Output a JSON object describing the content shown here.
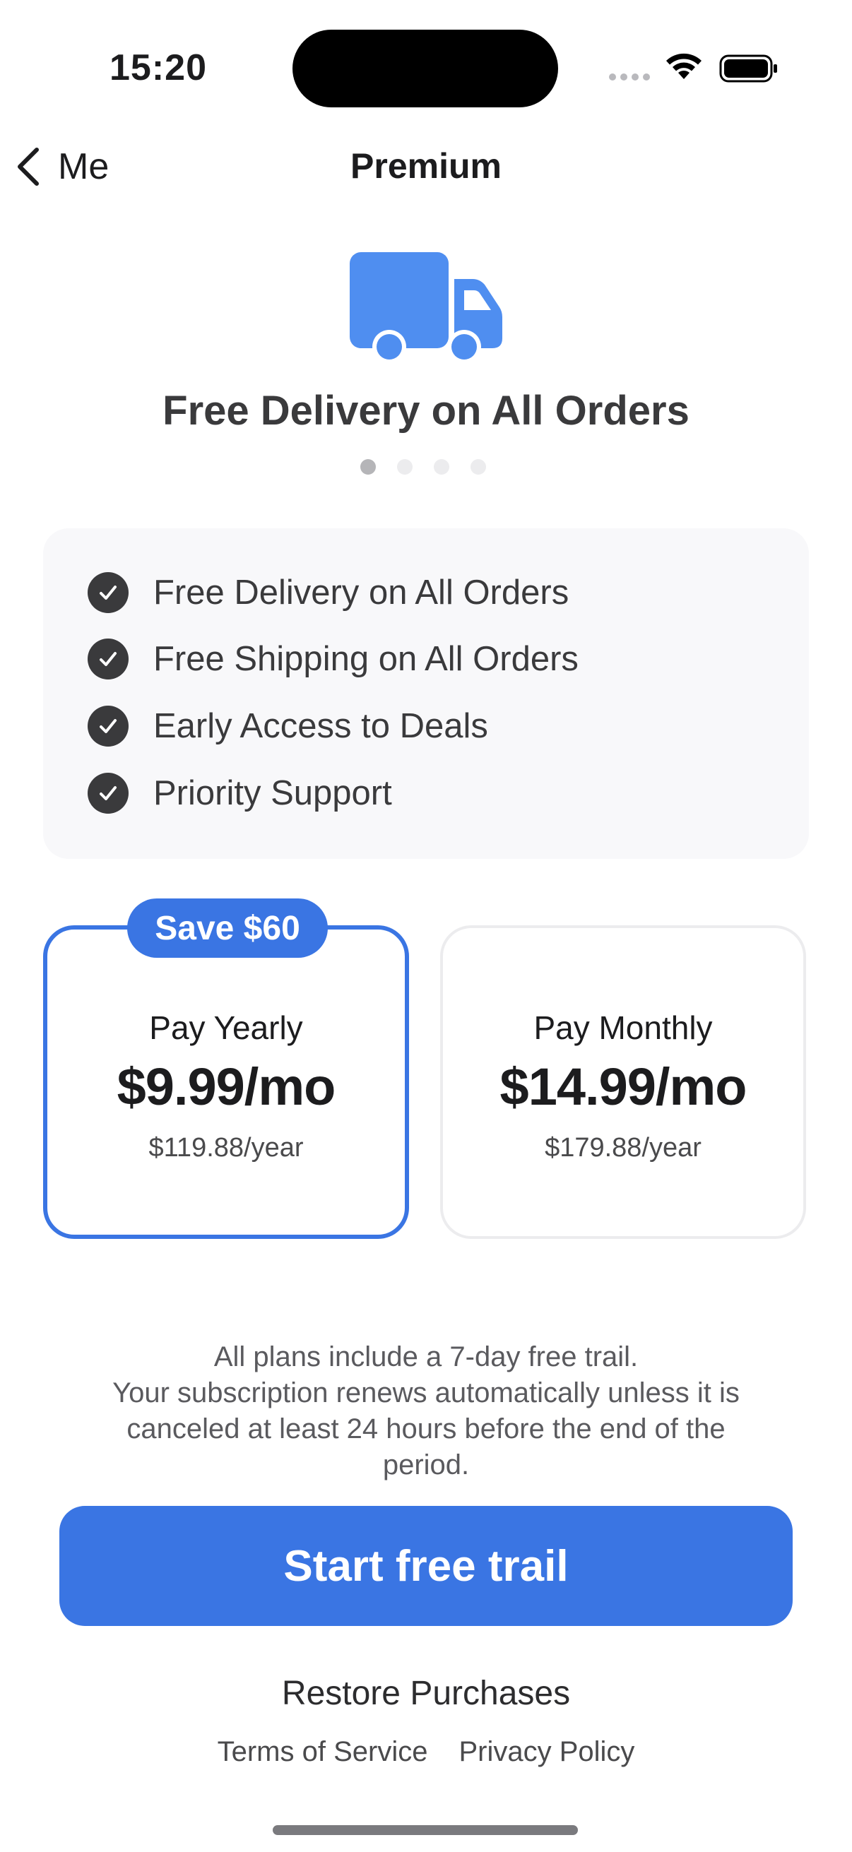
{
  "status_bar": {
    "time": "15:20"
  },
  "nav": {
    "back_label": "Me",
    "title": "Premium"
  },
  "hero": {
    "icon": "truck-icon",
    "title": "Free Delivery on All Orders",
    "page_count": 4,
    "active_page": 1
  },
  "features": [
    {
      "label": "Free Delivery on All Orders"
    },
    {
      "label": "Free Shipping on All Orders"
    },
    {
      "label": "Early Access to Deals"
    },
    {
      "label": "Priority Support"
    }
  ],
  "plans": {
    "yearly": {
      "badge": "Save $60",
      "name": "Pay Yearly",
      "price": "$9.99/mo",
      "subtext": "$119.88/year",
      "selected": true
    },
    "monthly": {
      "name": "Pay Monthly",
      "price": "$14.99/mo",
      "subtext": "$179.88/year",
      "selected": false
    }
  },
  "disclaimer": {
    "lines": [
      "All plans include a 7-day free trail.",
      "Your subscription renews automatically unless it is",
      "canceled at least 24 hours before the end of the",
      "period."
    ]
  },
  "cta": {
    "label": "Start free trail"
  },
  "footer": {
    "restore_label": "Restore Purchases",
    "terms_label": "Terms of Service",
    "privacy_label": "Privacy Policy"
  },
  "colors": {
    "accent": "#3a75e3",
    "truck": "#4f8ef0",
    "text_dark": "#1c1c1e",
    "card_bg": "#f8f8fa"
  }
}
